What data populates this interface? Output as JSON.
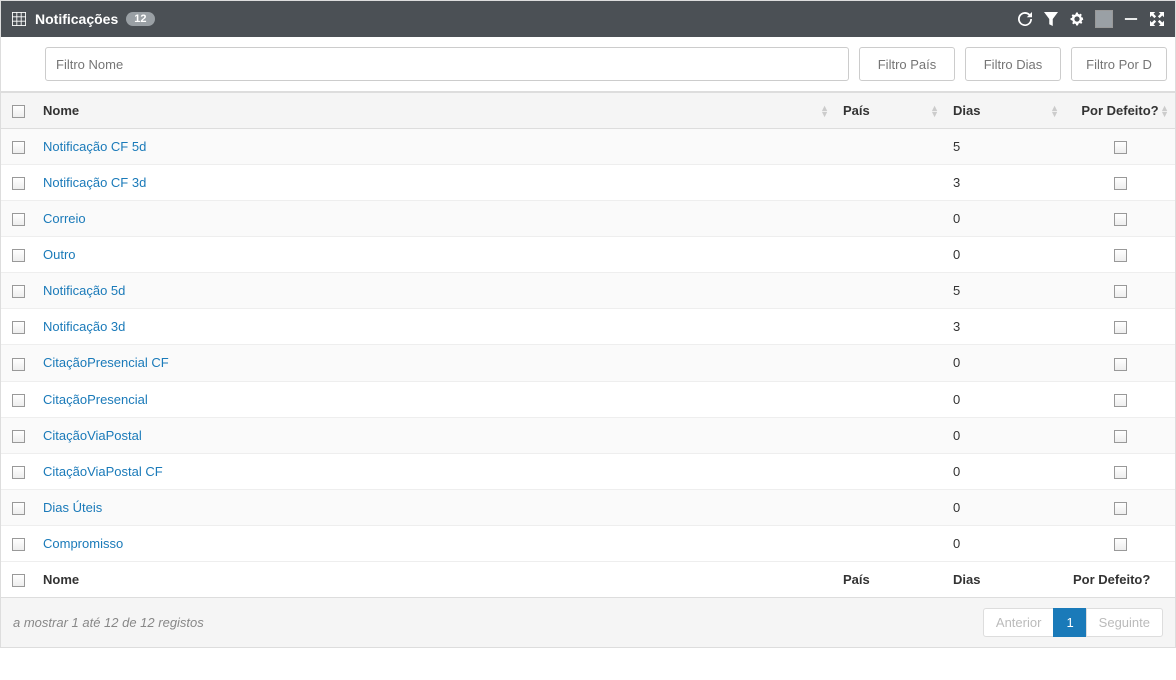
{
  "header": {
    "title": "Notificações",
    "count": "12"
  },
  "filters": {
    "nome_placeholder": "Filtro Nome",
    "pais_placeholder": "Filtro País",
    "dias_placeholder": "Filtro Dias",
    "def_placeholder": "Filtro Por D"
  },
  "columns": {
    "nome": "Nome",
    "pais": "País",
    "dias": "Dias",
    "def": "Por Defeito?"
  },
  "rows": [
    {
      "nome": "Notificação CF 5d",
      "pais": "",
      "dias": "5",
      "def": false
    },
    {
      "nome": "Notificação CF 3d",
      "pais": "",
      "dias": "3",
      "def": false
    },
    {
      "nome": "Correio",
      "pais": "",
      "dias": "0",
      "def": false
    },
    {
      "nome": "Outro",
      "pais": "",
      "dias": "0",
      "def": false
    },
    {
      "nome": "Notificação 5d",
      "pais": "",
      "dias": "5",
      "def": false
    },
    {
      "nome": "Notificação 3d",
      "pais": "",
      "dias": "3",
      "def": false
    },
    {
      "nome": "CitaçãoPresencial CF",
      "pais": "",
      "dias": "0",
      "def": false
    },
    {
      "nome": "CitaçãoPresencial",
      "pais": "",
      "dias": "0",
      "def": false
    },
    {
      "nome": "CitaçãoViaPostal",
      "pais": "",
      "dias": "0",
      "def": false
    },
    {
      "nome": "CitaçãoViaPostal CF",
      "pais": "",
      "dias": "0",
      "def": false
    },
    {
      "nome": "Dias Úteis",
      "pais": "",
      "dias": "0",
      "def": false
    },
    {
      "nome": "Compromisso",
      "pais": "",
      "dias": "0",
      "def": false
    }
  ],
  "footer": {
    "info": "a mostrar 1 até 12 de 12 registos",
    "prev": "Anterior",
    "next": "Seguinte",
    "page": "1"
  }
}
